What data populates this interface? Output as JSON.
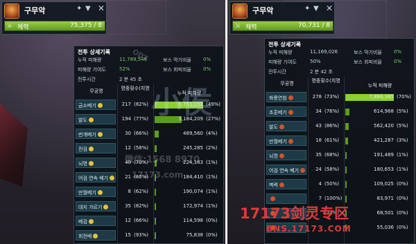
{
  "left": {
    "target": {
      "name": "구무악",
      "hp_label": "체력",
      "hp_value": "75,375 / 8",
      "hp_fill": 1.0
    },
    "panel": {
      "title": "전투 상세기록",
      "stats": [
        {
          "label": "누적 피해량",
          "value": "11,789,549"
        },
        {
          "label": "피해량 기여도",
          "value": "52%"
        },
        {
          "label": "전투시간",
          "value": "2 분 45 초"
        }
      ],
      "stats_right": [
        {
          "label": "보스 막기비율",
          "value": "0%"
        },
        {
          "label": "보스 회피비율",
          "value": "0%"
        }
      ],
      "headers": {
        "name": "무공명",
        "count": "명중횟수(치명",
        "damage": "누적 피해량"
      },
      "rows": [
        {
          "name": "금소베기",
          "emblem": "gold",
          "count": "217",
          "crit": "(82%)",
          "damage": "5,751,051",
          "pct": "(49%)",
          "share": 0.49
        },
        {
          "name": "발도",
          "emblem": "gold",
          "count": "194",
          "crit": "(77%)",
          "damage": "3,184,209",
          "pct": "(27%)",
          "share": 0.27
        },
        {
          "name": "번개베기",
          "emblem": "gold",
          "count": "30",
          "crit": "(66%)",
          "damage": "489,560",
          "pct": "(4%)",
          "share": 0.04
        },
        {
          "name": "전검",
          "emblem": "gold",
          "count": "12",
          "crit": "(58%)",
          "damage": "245,285",
          "pct": "(2%)",
          "share": 0.02
        },
        {
          "name": "뇌명",
          "emblem": "gold",
          "count": "40",
          "crit": "(70%)",
          "damage": "224,183",
          "pct": "(1%)",
          "share": 0.019
        },
        {
          "name": "어검 연속 베기",
          "emblem": "gold",
          "count": "21",
          "crit": "(80%)",
          "damage": "184,410",
          "pct": "(1%)",
          "share": 0.016
        },
        {
          "name": "만월베기",
          "emblem": "gold",
          "count": "8",
          "crit": "(62%)",
          "damage": "190,074",
          "pct": "(1%)",
          "share": 0.016
        },
        {
          "name": "대지 가르기",
          "emblem": "gold",
          "count": "35",
          "crit": "(82%)",
          "damage": "172,974",
          "pct": "(1%)",
          "share": 0.015
        },
        {
          "name": "베검",
          "emblem": "gold",
          "count": "12",
          "crit": "(66%)",
          "damage": "114,598",
          "pct": "(0%)",
          "share": 0.01
        },
        {
          "name": "회전베",
          "emblem": "gold",
          "count": "15",
          "crit": "(93%)",
          "damage": "75,838",
          "pct": "(0%)",
          "share": 0.006
        }
      ]
    }
  },
  "right": {
    "target": {
      "name": "구무악",
      "hp_label": "체력",
      "hp_value": "70,731 / 8",
      "hp_fill": 1.0
    },
    "panel": {
      "title": "전투 상세기록",
      "stats": [
        {
          "label": "누적 피해량",
          "value": "11,169,026"
        },
        {
          "label": "피해량 기여도",
          "value": "50%"
        },
        {
          "label": "전투시간",
          "value": "2 분 42 초"
        }
      ],
      "stats_right": [
        {
          "label": "보스 막기비율",
          "value": "0%"
        },
        {
          "label": "보스 회피비율",
          "value": "0%"
        }
      ],
      "headers": {
        "name": "무공명",
        "count": "명중횟수(치명",
        "damage": "누적 피해량"
      },
      "rows": [
        {
          "name": "화룡연참",
          "emblem": "red",
          "count": "278",
          "crit": "(73%)",
          "damage": "7,886,365",
          "pct": "(70%)",
          "share": 0.7
        },
        {
          "name": "초혼베기",
          "emblem": "red",
          "count": "34",
          "crit": "(76%)",
          "damage": "614,968",
          "pct": "(5%)",
          "share": 0.055
        },
        {
          "name": "발도",
          "emblem": "red",
          "count": "43",
          "crit": "(86%)",
          "damage": "562,420",
          "pct": "(5%)",
          "share": 0.05
        },
        {
          "name": "만월베기",
          "emblem": "red",
          "count": "18",
          "crit": "(61%)",
          "damage": "421,287",
          "pct": "(3%)",
          "share": 0.038
        },
        {
          "name": "뇌명",
          "emblem": "red",
          "count": "35",
          "crit": "(68%)",
          "damage": "191,489",
          "pct": "(1%)",
          "share": 0.017
        },
        {
          "name": "어검 연속 베기",
          "emblem": "red",
          "count": "24",
          "crit": "(58%)",
          "damage": "180,653",
          "pct": "(1%)",
          "share": 0.016
        },
        {
          "name": "벽력",
          "emblem": "red",
          "count": "4",
          "crit": "(50%)",
          "damage": "109,025",
          "pct": "(0%)",
          "share": 0.01
        },
        {
          "name": "",
          "emblem": "red",
          "count": "7",
          "crit": "(100%)",
          "damage": "83,971",
          "pct": "(0%)",
          "share": 0.0075
        },
        {
          "name": "",
          "emblem": "red",
          "count": "",
          "crit": "(73%)",
          "damage": "68,501",
          "pct": "(0%)",
          "share": 0.006
        },
        {
          "name": "",
          "emblem": "red",
          "count": "",
          "crit": "",
          "damage": "55,036",
          "pct": "(0%)",
          "share": 0.005
        }
      ]
    }
  },
  "watermarks": {
    "center": "小侯",
    "left_odt": "ODT",
    "left_phone": "微信:1568 8970",
    "left_phone2": "17173.com",
    "site_cn": "17173剑灵专区",
    "site_url": "BNS.17173.COM"
  },
  "icons": {
    "target_pin": "pin-icon",
    "target_menu": "triangle-down-icon",
    "target_close": "close-icon",
    "hp_sword": "sword-icon"
  },
  "colors": {
    "hp": "#8bcf32",
    "bar": "#5c9d1d",
    "bar_top": "#8bcf32",
    "name_box": "#1d3a46",
    "stat_value": "#7fd06a",
    "watermark_red": "#e03a3a"
  }
}
